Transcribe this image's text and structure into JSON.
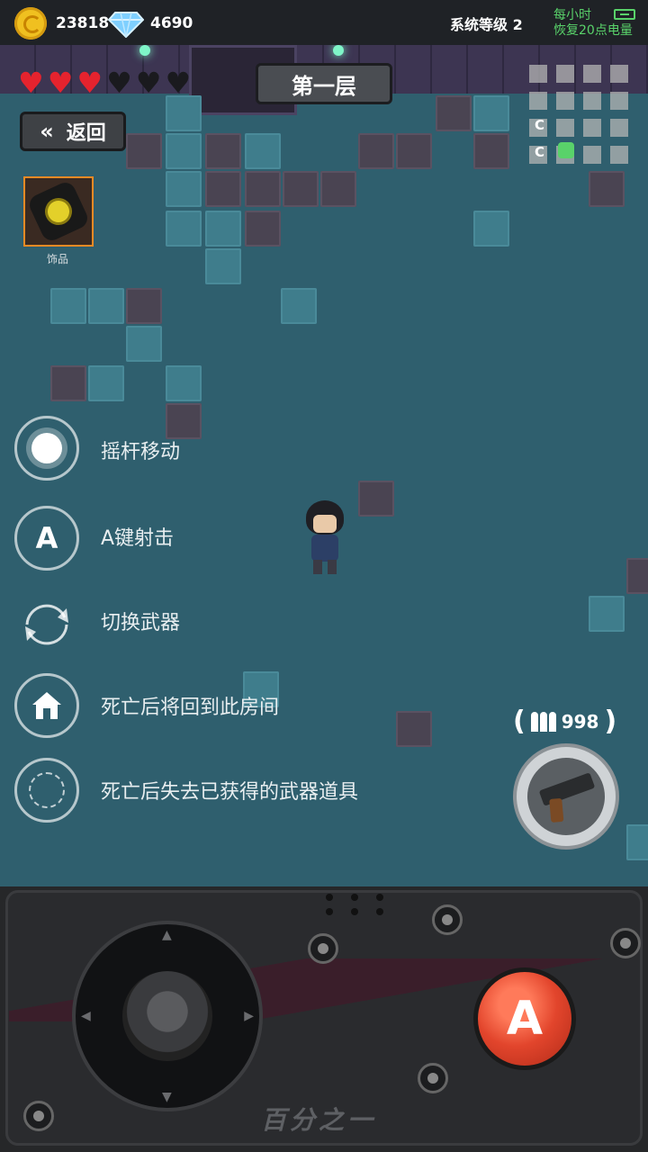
{
  "currency": {
    "coins": "23818",
    "gems": "4690"
  },
  "system": {
    "level_label": "系统等级 2",
    "energy_line1": "每小时",
    "energy_line2": "恢复20点电量"
  },
  "hearts": {
    "full": 3,
    "empty": 3
  },
  "floor": {
    "title": "第一层"
  },
  "back_button": {
    "label": "返回"
  },
  "accessory": {
    "label": "饰品"
  },
  "minimap": {
    "marker1": "C",
    "marker2": "C"
  },
  "hints": [
    {
      "icon": "joystick-icon",
      "text": "摇杆移动"
    },
    {
      "icon": "a-button-icon",
      "text": "A键射击",
      "icon_label": "A"
    },
    {
      "icon": "swap-icon",
      "text": "切换武器"
    },
    {
      "icon": "home-icon",
      "text": "死亡后将回到此房间"
    },
    {
      "icon": "dashed-circle-icon",
      "text": "死亡后失去已获得的武器道具"
    }
  ],
  "weapon": {
    "ammo": "998"
  },
  "controller": {
    "fire_label": "A",
    "brand": "百分之一"
  },
  "colors": {
    "accent_green": "#59d26a",
    "fire_red": "#e2452c",
    "coin_gold": "#f0c020",
    "gem_blue": "#7fd0ff"
  }
}
